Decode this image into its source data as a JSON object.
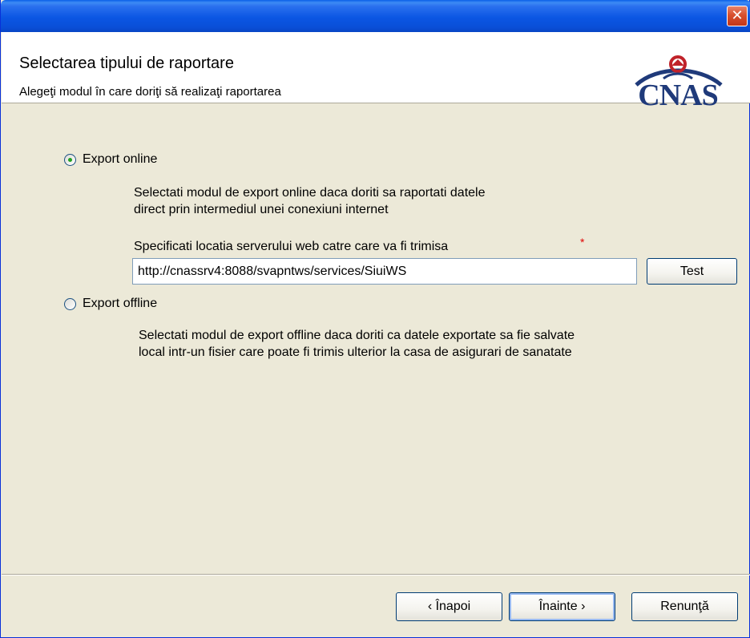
{
  "window": {
    "close_label": "✕"
  },
  "header": {
    "title": "Selectarea tipului de raportare",
    "subtitle": "Alegeţi modul în care doriţi să realizaţi raportarea",
    "logo_text": "CNAS"
  },
  "options": {
    "online": {
      "label": "Export online",
      "selected": true,
      "description_line1": "Selectati modul de export online daca doriti sa raportati datele",
      "description_line2": "direct prin intermediul unei conexiuni internet",
      "server_label": "Specificati locatia serverului web catre care va fi trimisa",
      "required_mark": "*",
      "server_url": "http://cnassrv4:8088/svapntws/services/SiuiWS",
      "test_button": "Test"
    },
    "offline": {
      "label": "Export offline",
      "selected": false,
      "description_line1": "Selectati modul de export offline daca doriti ca datele exportate sa fie salvate",
      "description_line2": "local intr-un fisier care poate fi trimis ulterior la casa de asigurari de sanatate"
    }
  },
  "footer": {
    "back_button": "‹ Înapoi",
    "next_button": "Înainte ›",
    "cancel_button": "Renunţă"
  },
  "colors": {
    "titlebar": "#0B56E3",
    "dialog_bg": "#ECE9D8",
    "logo": "#1F3A7A",
    "required": "#E00000"
  }
}
